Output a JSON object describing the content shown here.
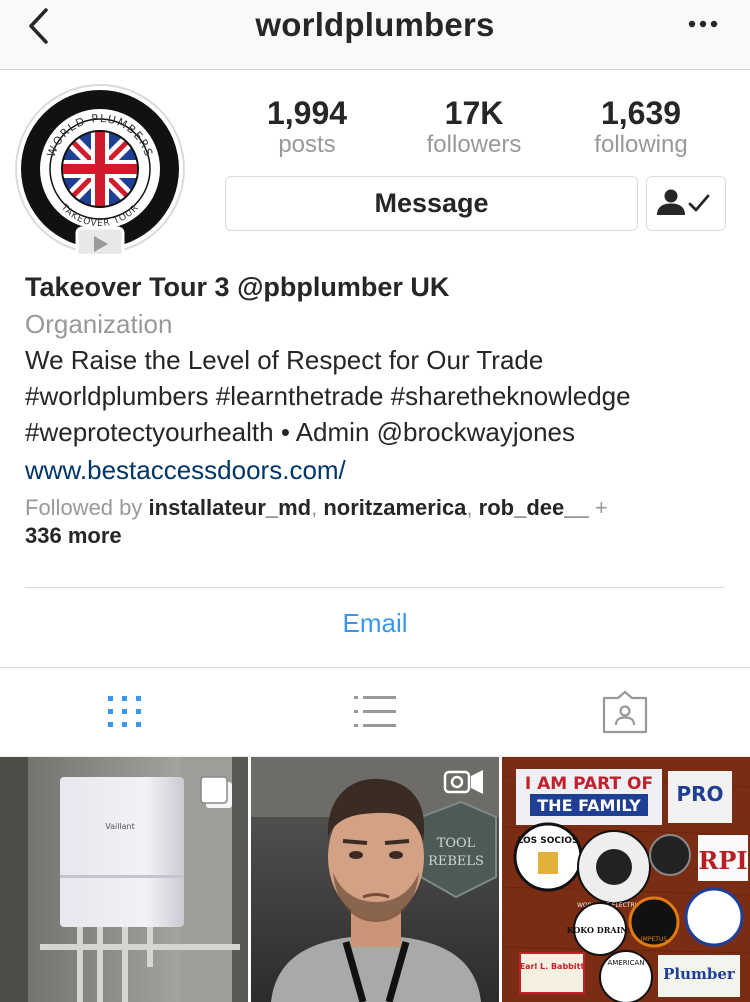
{
  "header": {
    "username": "worldplumbers",
    "back_icon": "chevron-left-icon",
    "more_icon": "more-dots-icon"
  },
  "profile": {
    "avatar_text_top": "WORLD PLUMBERS",
    "avatar_text_bottom": "TAKEOVER TOUR",
    "avatar_badge_icon": "video-play-icon",
    "stats": [
      {
        "value": "1,994",
        "label": "posts"
      },
      {
        "value": "17K",
        "label": "followers"
      },
      {
        "value": "1,639",
        "label": "following"
      }
    ],
    "message_label": "Message",
    "following_icon": "person-check-icon"
  },
  "bio": {
    "name": "Takeover Tour 3 @pbplumber UK",
    "category": "Organization",
    "line1": "We Raise the Level of Respect for Our Trade",
    "line2": "#worldplumbers #learnthetrade #sharetheknowledge",
    "line3": "#weprotectyourhealth • Admin @brockwayjones",
    "link": "www.bestaccessdoors.com/",
    "followed_prefix": "Followed by ",
    "followed_user1": "installateur_md",
    "followed_sep1": ", ",
    "followed_user2": "noritzamerica",
    "followed_sep2": ", ",
    "followed_user3": "rob_dee__",
    "followed_plus": " + ",
    "followed_more": "336 more"
  },
  "contact": {
    "email_label": "Email"
  },
  "tabs": [
    {
      "icon": "grid-icon",
      "active": true,
      "color": "#3897f0"
    },
    {
      "icon": "list-icon",
      "active": false,
      "color": "#999999"
    },
    {
      "icon": "tagged-icon",
      "active": false,
      "color": "#999999"
    }
  ],
  "posts": [
    {
      "type": "carousel",
      "badge_icon": "carousel-icon",
      "boiler_brand": "Vaillant"
    },
    {
      "type": "video",
      "badge_icon": "video-camera-icon",
      "sign_text_1": "TOOL",
      "sign_text_2": "REBELS"
    },
    {
      "type": "image",
      "sticker_texts": [
        "I AM PART OF",
        "THE FAMILY",
        "LOS SOCIOS",
        "KOKO DRAINS",
        "RPI",
        "PRO",
        "Plumber",
        "AMERICAN",
        "Earl L. Babbitt",
        "IMPETUS",
        "WORLD OF ELECTRICIAN"
      ]
    }
  ],
  "colors": {
    "accent": "#3897f0",
    "link": "#003569",
    "muted": "#999999",
    "text": "#262626"
  }
}
